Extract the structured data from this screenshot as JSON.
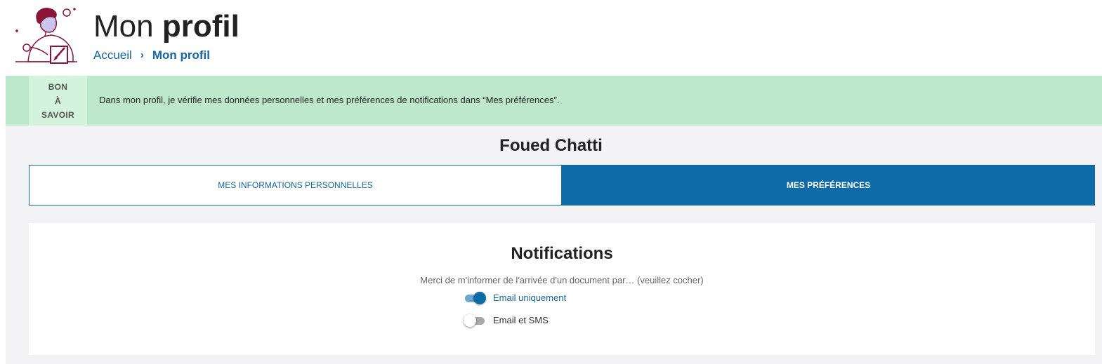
{
  "header": {
    "title_light": "Mon",
    "title_bold": "profil",
    "breadcrumb": {
      "home": "Accueil",
      "separator": "›",
      "current": "Mon profil"
    },
    "illustration_icon": "person-writing-illustration"
  },
  "info_banner": {
    "tag_lines": [
      "BON",
      "À",
      "SAVOIR"
    ],
    "text": "Dans mon profil, je vérifie mes données personnelles et mes préférences de notifications dans “Mes préférences”."
  },
  "user": {
    "name": "Foued Chatti"
  },
  "tabs": [
    {
      "label": "MES INFORMATIONS PERSONNELLES",
      "active": false
    },
    {
      "label": "MES PRÉFÉRENCES",
      "active": true
    }
  ],
  "notifications": {
    "title": "Notifications",
    "subtitle": "Merci de m'informer de l'arrivée d'un document par… (veuillez cocher)",
    "options": [
      {
        "label": "Email uniquement",
        "checked": true
      },
      {
        "label": "Email et SMS",
        "checked": false
      }
    ]
  },
  "colors": {
    "brand_blue": "#0f6aa8",
    "banner_green": "#bee8cb",
    "illustration_accent": "#8b1538"
  }
}
